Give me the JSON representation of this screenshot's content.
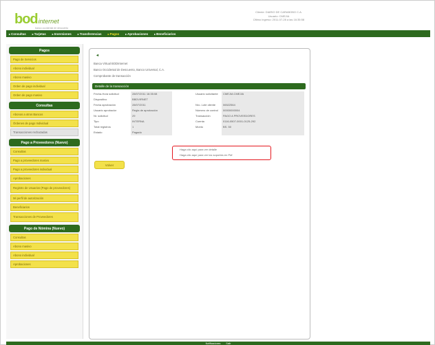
{
  "header": {
    "logo": {
      "brand": "bod",
      "suffix": "internet",
      "tagline": "banco occidental de descuento"
    },
    "user_lines": [
      "Cliente: DIARIO DE CARABOBO C.A.",
      "Usuario: CMEJIA",
      "Último ingreso: 2011-07-28 a las 16:35:58"
    ]
  },
  "topnav": [
    "Consultas",
    "Tarjetas",
    "Inversiones",
    "Transferencias",
    "Pagos",
    "Aprobaciones",
    "Beneficiarios"
  ],
  "topnav_active": "Pagos",
  "sidebar": {
    "sections": [
      {
        "title": "Pagos",
        "items": [
          "Pago de Servicios",
          "Abono individual",
          "Abono masivo",
          "Orden de pago individual",
          "Orden de pago masivo"
        ]
      },
      {
        "title": "Consultas",
        "items": [
          "Abonos a otros Bancos",
          "Órdenes de pago Individual",
          "Transacciones rechazadas"
        ]
      },
      {
        "title": "Pago a Proveedores (Nuevo)",
        "items": [
          "Consultas",
          "Pago a proveedores masivo",
          "Pago a proveedores individual",
          "Aprobaciones",
          "Registro de Usuarios (Pago de proveedores)",
          "Mi perfil de autorización",
          "Beneficiarios",
          "Transacciones de Proveedores"
        ]
      },
      {
        "title": "Pago de Nómina (Nuevo)",
        "items": [
          "Consultas",
          "Abono masivo",
          "Abono individual",
          "Aprobaciones"
        ]
      }
    ]
  },
  "content": {
    "back": "◂",
    "bank_lines": [
      "Banca Virtual BODInternet",
      "Banco Occidental de Descuento, Banco Universal, C.A.",
      "Comprobante de transacción"
    ],
    "detail_title": "Detalle de la transacción",
    "rows": [
      {
        "l1": "Fecha-Hora solicitud",
        "v1": "28/07/2011 16:35:08",
        "l2": "Usuario solicitante",
        "v2": "CMEJIA CMEJIA"
      },
      {
        "l1": "Dispositivo",
        "v1": "BBDVIRNET",
        "l2": "",
        "v2": ""
      },
      {
        "l1": "Fecha aprobación",
        "v1": "28/07/2011",
        "l2": "Nro. Lote cliente",
        "v2": "06522564"
      },
      {
        "l1": "Usuario aprobador",
        "v1": "Regla de aprobación",
        "l2": "Número de control",
        "v2": "00000000004"
      },
      {
        "l1": "Nr. solicitud",
        "v1": "29",
        "l2": "Transacción",
        "v2": "PAGO A PROVEEDORES"
      },
      {
        "l1": "Tipo",
        "v1": "INTERNA",
        "l2": "Cuenta",
        "v2": "0116-0507-0001-0125-292"
      },
      {
        "l1": "Total registros",
        "v1": "1",
        "l2": "Monto",
        "v2": "BS. 50"
      },
      {
        "l1": "Estado",
        "v1": "Pagado",
        "l2": "",
        "v2": ""
      }
    ],
    "notes": [
      "Haga clic aquí para ver detalle",
      "Haga clic aquí para ver los soportes en Pdf"
    ],
    "volver": "Volver"
  },
  "footer": [
    "Notificaciones",
    "Salir"
  ],
  "colors": {
    "brand_green": "#2d6a1e",
    "accent_yellow": "#f3e14a",
    "highlight_red": "#e4151c"
  }
}
